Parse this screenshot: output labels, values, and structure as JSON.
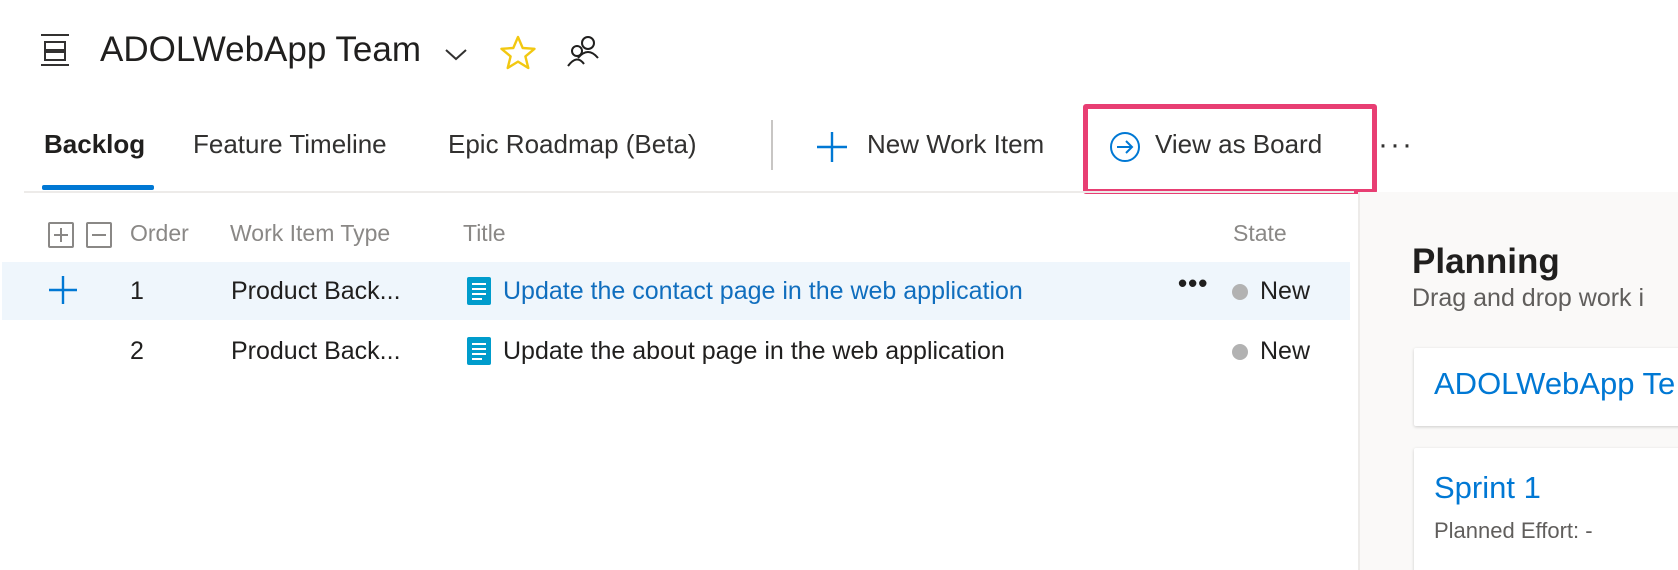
{
  "header": {
    "team_name": "ADOLWebApp Team",
    "icons": [
      "backlog-icon",
      "chevron-down-icon",
      "favorite-star-icon",
      "team-members-icon"
    ],
    "star_color": "#f2c811"
  },
  "tabs": [
    {
      "label": "Backlog",
      "active": true
    },
    {
      "label": "Feature Timeline",
      "active": false
    },
    {
      "label": "Epic Roadmap (Beta)",
      "active": false
    }
  ],
  "commands": {
    "new_work_item": "New Work Item",
    "view_as_board": "View as Board",
    "more": "···"
  },
  "grid": {
    "columns": {
      "order": "Order",
      "type": "Work Item Type",
      "title": "Title",
      "state": "State"
    },
    "rows": [
      {
        "order": "1",
        "type": "Product Back...",
        "title": "Update the contact page in the web application",
        "state": "New",
        "selected": true
      },
      {
        "order": "2",
        "type": "Product Back...",
        "title": "Update the about page in the web application",
        "state": "New",
        "selected": false
      }
    ],
    "row_more": "•••"
  },
  "planning": {
    "title": "Planning",
    "subtitle": "Drag and drop work i",
    "cards": [
      {
        "title": "ADOLWebApp Te",
        "subtitle": ""
      },
      {
        "title": "Sprint 1",
        "subtitle": "Planned Effort: -"
      }
    ]
  },
  "colors": {
    "accent": "#0078d4",
    "highlight_box": "#e83e73",
    "work_item_blue": "#009ccc",
    "state_new_dot": "#b2b2b2",
    "selected_row": "#eff6fc"
  }
}
